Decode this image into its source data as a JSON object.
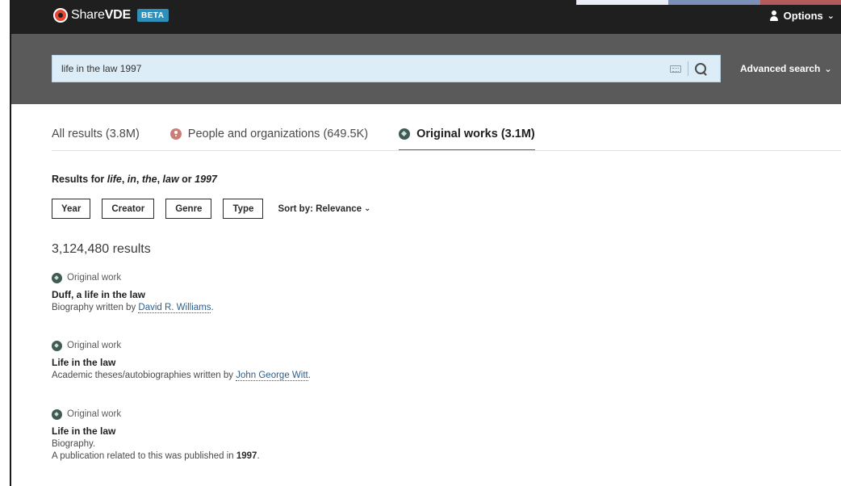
{
  "header": {
    "logo_prefix": "Share",
    "logo_bold": "VDE",
    "badge": "BETA",
    "options_label": "Options",
    "logo_color": "#e8452f",
    "badge_color": "#2e8fb8"
  },
  "search": {
    "value": "life in the law 1997",
    "advanced_label": "Advanced search"
  },
  "tabs": [
    {
      "label": "All results (3.8M)",
      "active": false
    },
    {
      "label": "People and organizations (649.5K)",
      "active": false,
      "icon": "person-icon"
    },
    {
      "label": "Original works (3.1M)",
      "active": true,
      "icon": "original-work-icon"
    }
  ],
  "results_for": {
    "prefix": "Results for ",
    "t1": "life",
    "t2": "in",
    "t3": "the",
    "t4": "law",
    "or": " or ",
    "t5": "1997"
  },
  "filters": {
    "year": "Year",
    "creator": "Creator",
    "genre": "Genre",
    "type": "Type",
    "sort_label": "Sort by: Relevance"
  },
  "result_count": "3,124,480 results",
  "results": [
    {
      "type": "Original work",
      "title": "Duff, a life in the law",
      "desc_prefix": "Biography written by ",
      "author": "David R. Williams",
      "desc_suffix": "."
    },
    {
      "type": "Original work",
      "title": "Life in the law",
      "desc_prefix": "Academic theses/autobiographies written by ",
      "author": "John George Witt",
      "desc_suffix": "."
    },
    {
      "type": "Original work",
      "title": "Life in the law",
      "desc_line1": "Biography.",
      "desc_prefix": "A publication related to this was published in ",
      "year": "1997",
      "desc_suffix": "."
    }
  ]
}
